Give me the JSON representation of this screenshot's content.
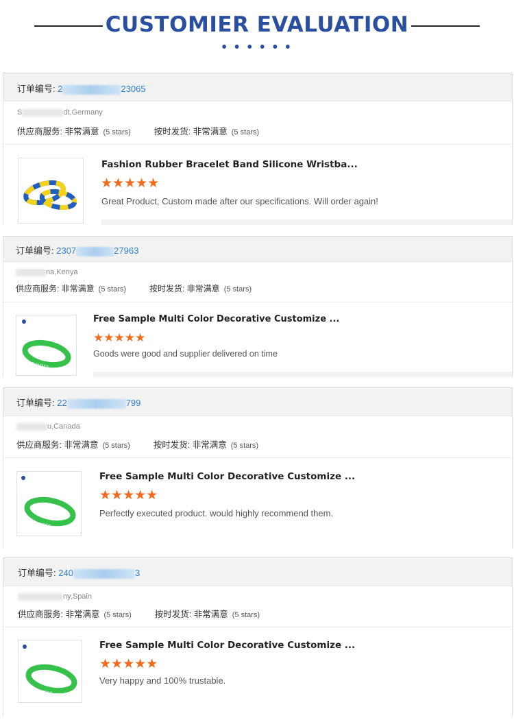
{
  "header": {
    "title": "CUSTOMIER EVALUATION",
    "dots": "• • • • • •"
  },
  "colors": {
    "accent": "#2a4fa0",
    "star": "#f26b1d",
    "order_link": "#2f7fd0"
  },
  "labels": {
    "order_no": "订单编号: ",
    "supplier_service": "供应商服务: 非常满意",
    "on_time_delivery": "按时发货: 非常满意"
  },
  "reviews": [
    {
      "order_prefix": "2",
      "order_suffix": "23065",
      "buyer_prefix": "S",
      "buyer_location": "dt,Germany",
      "service_stars": "(5 stars)",
      "delivery_stars": "(5 stars)",
      "product_name": "Fashion Rubber Bracelet Band Silicone Wristba...",
      "rating": 5,
      "stars_text": "★★★★★",
      "review": "Great Product, Custom made after our specifications. Will order again!",
      "thumb_icon": "blue-yellow-wristband-image"
    },
    {
      "order_prefix": "2307",
      "order_suffix": "27963",
      "buyer_prefix": "",
      "buyer_location": "na,Kenya",
      "service_stars": "(5 stars)",
      "delivery_stars": "(5 stars)",
      "product_name": "Free Sample Multi Color Decorative Customize ...",
      "rating": 5,
      "stars_text": "★★★★★",
      "review": "Goods were good and supplier delivered on time",
      "thumb_icon": "green-wristband-image"
    },
    {
      "order_prefix": "22",
      "order_suffix": "799",
      "buyer_prefix": "",
      "buyer_location": "u,Canada",
      "service_stars": "(5 stars)",
      "delivery_stars": "(5 stars)",
      "product_name": "Free Sample Multi Color Decorative Customize ...",
      "rating": 5,
      "stars_text": "★★★★★",
      "review": "Perfectly executed product. would highly recommend them.",
      "thumb_icon": "green-wristband-image"
    },
    {
      "order_prefix": "240",
      "order_suffix": "3",
      "buyer_prefix": "",
      "buyer_location": "ny,Spain",
      "service_stars": "(5 stars)",
      "delivery_stars": "(5 stars)",
      "product_name": "Free Sample Multi Color Decorative Customize ...",
      "rating": 5,
      "stars_text": "★★★★★",
      "review": "Very happy and 100% trustable.",
      "thumb_icon": "green-wristband-image"
    }
  ]
}
